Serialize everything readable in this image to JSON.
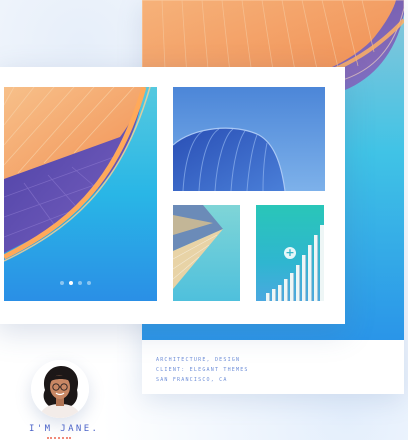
{
  "portfolio": {
    "caption": {
      "line1": "ARCHITECTURE, DESIGN",
      "line2": "CLIENT: ELEGANT THEMES",
      "line3": "SAN FRANCISCO, CA"
    },
    "gallery": {
      "images": [
        {
          "name": "curved-facade",
          "icon": "image"
        },
        {
          "name": "blue-dome",
          "icon": "image"
        },
        {
          "name": "angled-building",
          "icon": "image"
        },
        {
          "name": "stepped-columns",
          "icon": "image"
        }
      ],
      "slides_total": 4,
      "slide_active_index": 1
    },
    "profile": {
      "name": "I'M JANE."
    },
    "colors": {
      "accent": "#4c64c8",
      "underline": "#f08a7a",
      "plus_icon": "#35b7c9"
    },
    "icons": {
      "expand": "plus-icon"
    }
  }
}
